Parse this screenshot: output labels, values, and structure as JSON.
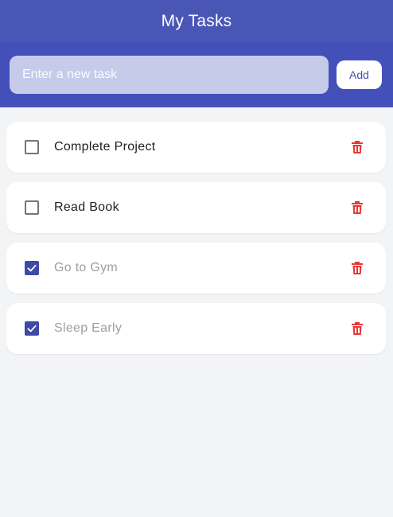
{
  "header": {
    "title": "My Tasks"
  },
  "input": {
    "placeholder": "Enter a new task",
    "value": ""
  },
  "add_button": {
    "label": "Add"
  },
  "colors": {
    "header_bg": "#4a56b5",
    "input_bar_bg": "#4350b9",
    "checkbox_checked": "#3f4aa6",
    "delete_icon": "#e53935",
    "completed_text": "#9e9e9e"
  },
  "tasks": [
    {
      "label": "Complete Project",
      "completed": false
    },
    {
      "label": "Read Book",
      "completed": false
    },
    {
      "label": "Go to Gym",
      "completed": true
    },
    {
      "label": "Sleep Early",
      "completed": true
    }
  ]
}
